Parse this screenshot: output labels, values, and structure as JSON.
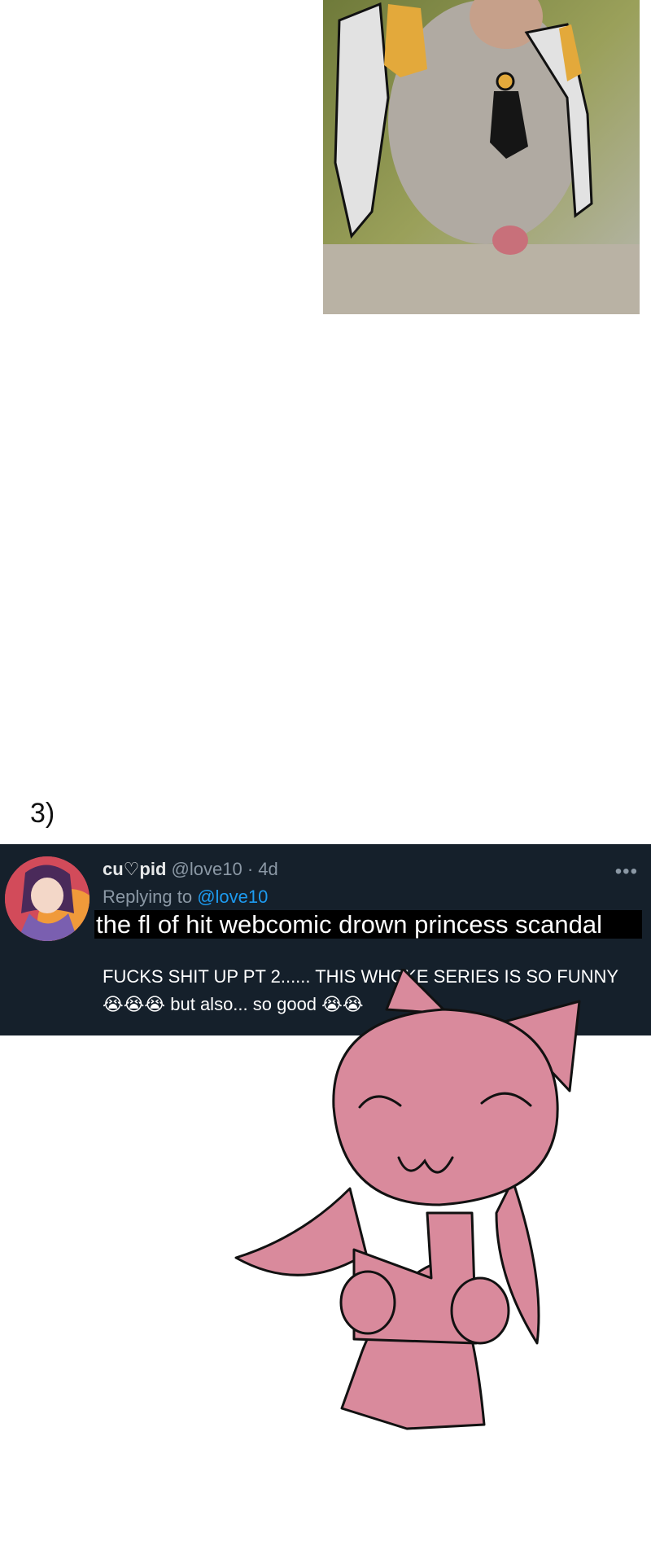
{
  "meme": {
    "step_label": "3)"
  },
  "tweet": {
    "display_name": "cu♡pid",
    "handle": "@love10",
    "separator": "·",
    "age": "4d",
    "more_icon": "ellipsis-icon",
    "reply_prefix": "Replying to",
    "reply_handle": "@love10",
    "caption_overlay": "the fl of hit webcomic drown princess scandal",
    "body_line1": "FUCKS SHIT UP PT 2...... THIS WHOKE SERIES IS SO FUNNY",
    "body_line2_emoji": "😭😭😭",
    "body_line2_text": "but also... so good",
    "body_line2_trailing_emoji": "😭😭",
    "colors": {
      "card_background": "#15202b",
      "link_blue": "#1d9bf0",
      "muted_gray": "#8b98a5",
      "caption_bar": "#000000"
    }
  },
  "images": {
    "top_photo": "baboon-photo-with-drawn-overlay",
    "avatar": "anime-avatar",
    "bottom_drawing": "pink-cat-character-drawing"
  }
}
